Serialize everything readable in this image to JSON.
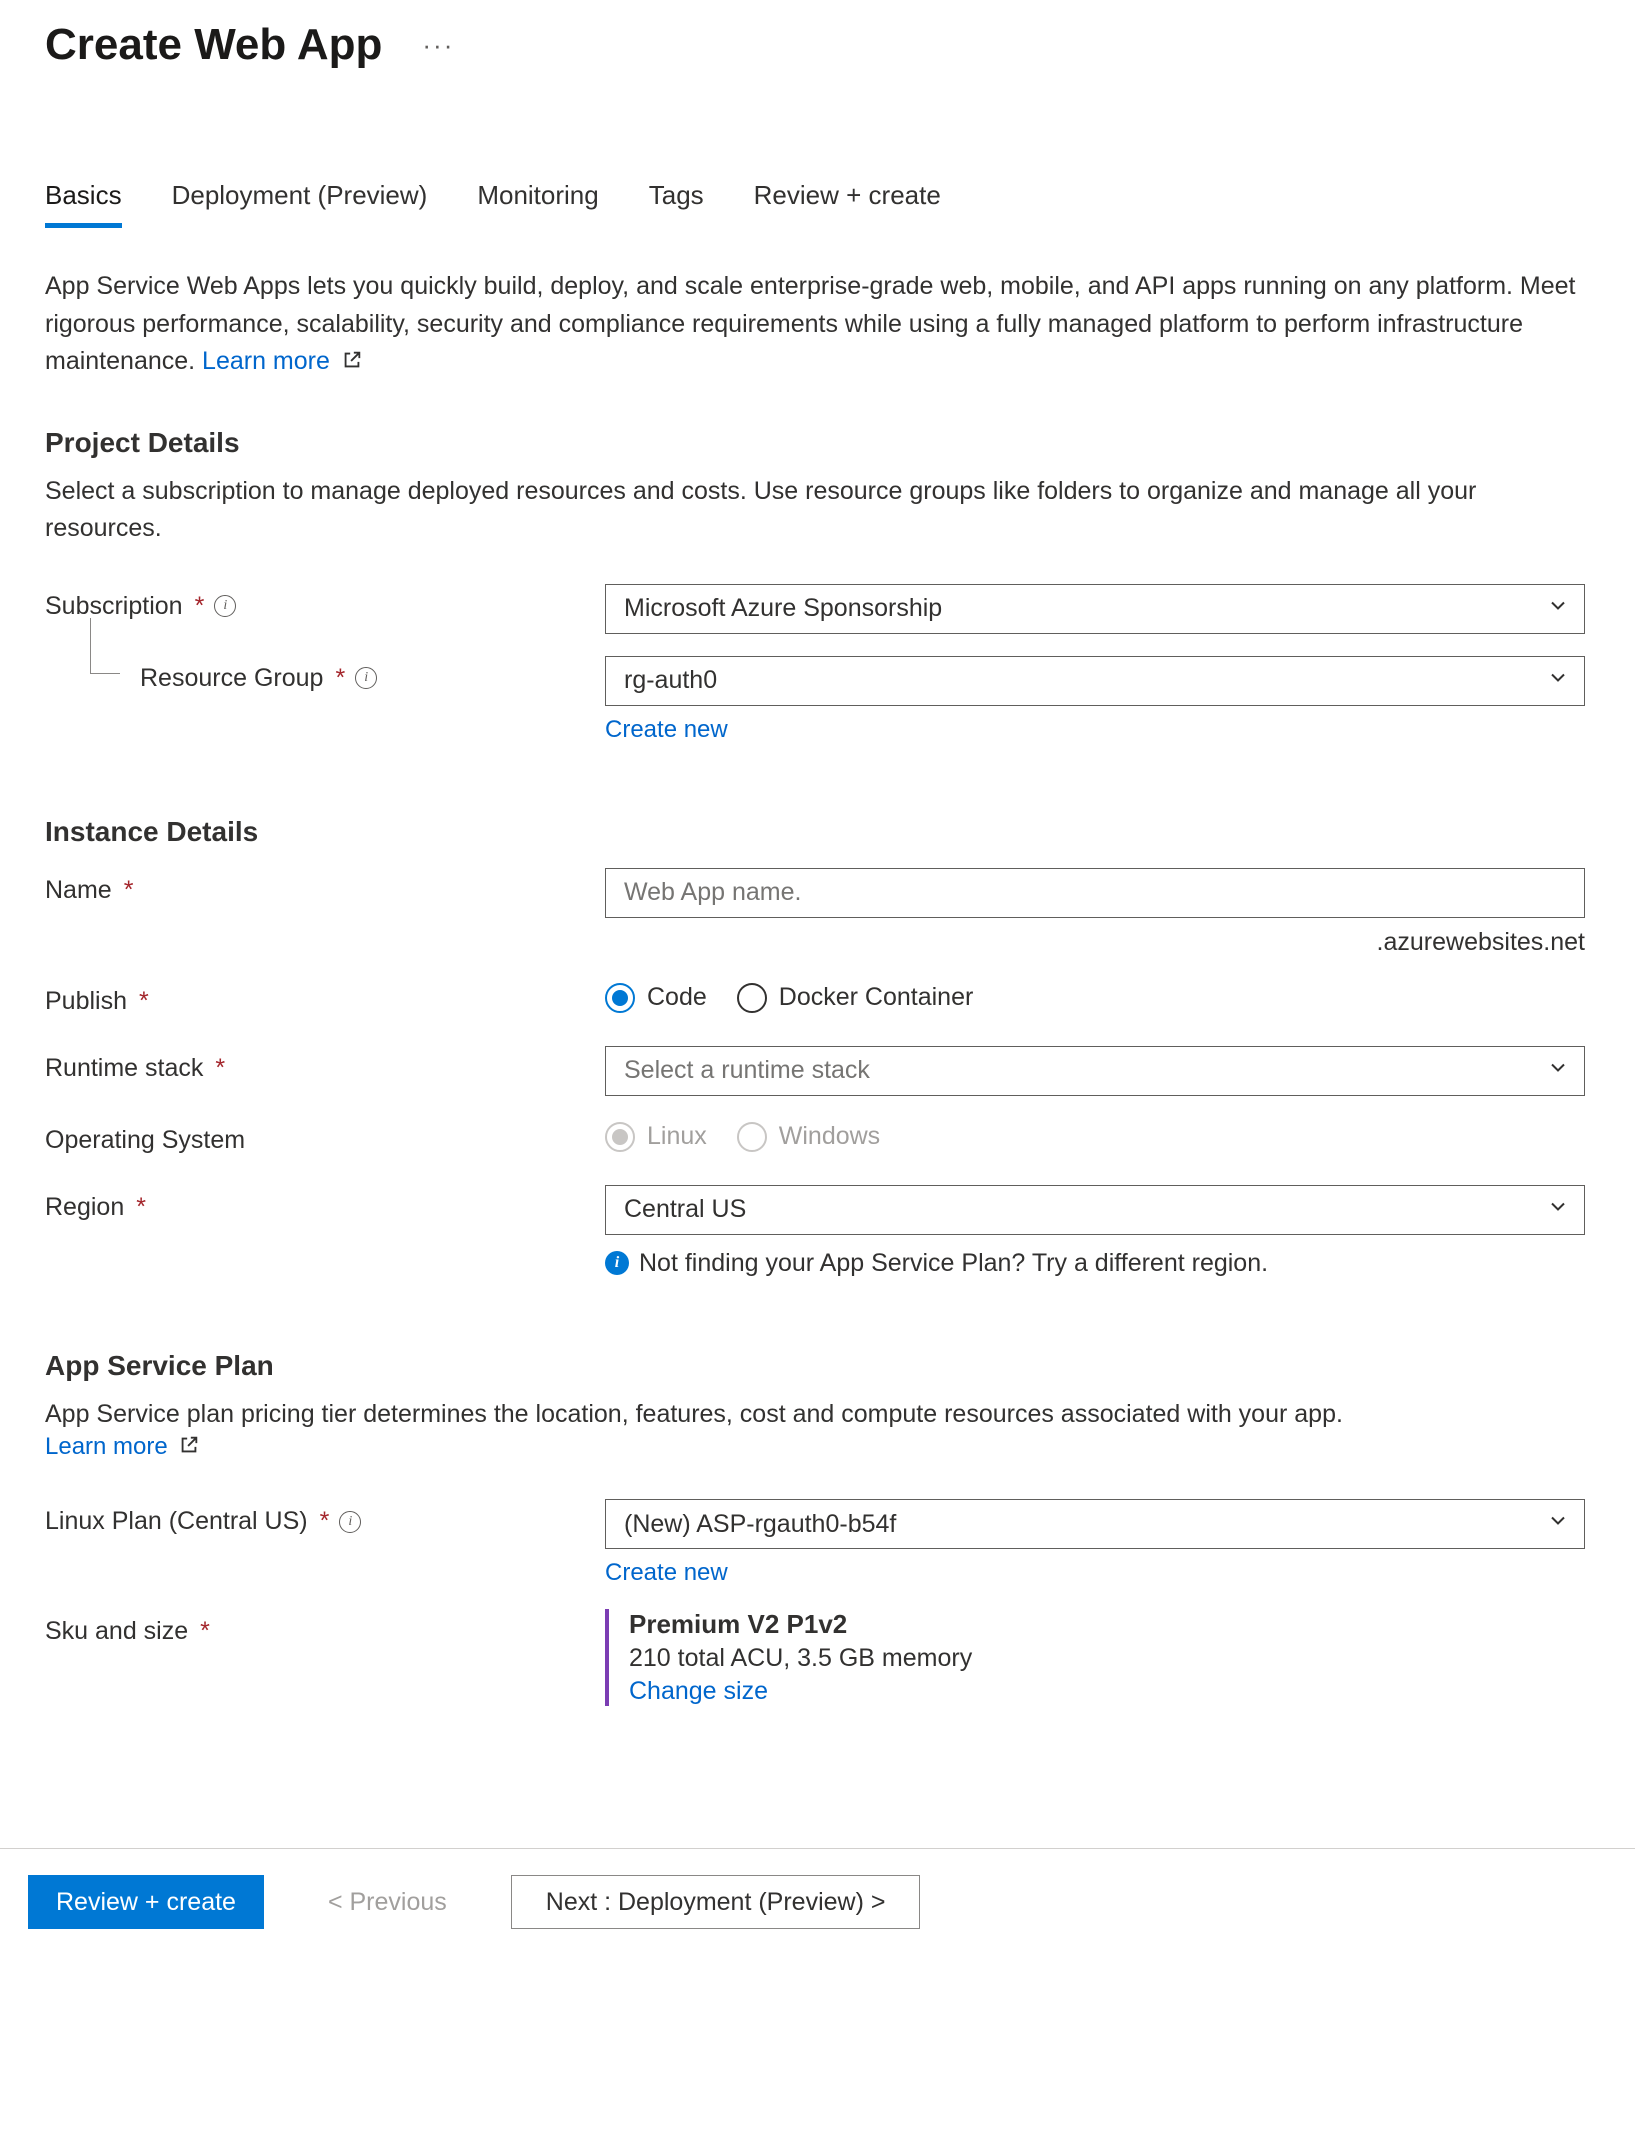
{
  "header": {
    "title": "Create Web App"
  },
  "tabs": [
    {
      "label": "Basics",
      "active": true
    },
    {
      "label": "Deployment (Preview)",
      "active": false
    },
    {
      "label": "Monitoring",
      "active": false
    },
    {
      "label": "Tags",
      "active": false
    },
    {
      "label": "Review + create",
      "active": false
    }
  ],
  "intro": {
    "text": "App Service Web Apps lets you quickly build, deploy, and scale enterprise-grade web, mobile, and API apps running on any platform. Meet rigorous performance, scalability, security and compliance requirements while using a fully managed platform to perform infrastructure maintenance.  ",
    "learn_more": "Learn more"
  },
  "project": {
    "title": "Project Details",
    "desc": "Select a subscription to manage deployed resources and costs. Use resource groups like folders to organize and manage all your resources.",
    "subscription_label": "Subscription",
    "subscription_value": "Microsoft Azure Sponsorship",
    "resource_group_label": "Resource Group",
    "resource_group_value": "rg-auth0",
    "create_new": "Create new"
  },
  "instance": {
    "title": "Instance Details",
    "name_label": "Name",
    "name_placeholder": "Web App name.",
    "name_suffix": ".azurewebsites.net",
    "publish_label": "Publish",
    "publish_options": {
      "code": "Code",
      "docker": "Docker Container"
    },
    "runtime_label": "Runtime stack",
    "runtime_placeholder": "Select a runtime stack",
    "os_label": "Operating System",
    "os_options": {
      "linux": "Linux",
      "windows": "Windows"
    },
    "region_label": "Region",
    "region_value": "Central US",
    "region_hint": "Not finding your App Service Plan? Try a different region."
  },
  "plan": {
    "title": "App Service Plan",
    "desc": "App Service plan pricing tier determines the location, features, cost and compute resources associated with your app.",
    "learn_more": "Learn more",
    "plan_label": "Linux Plan (Central US)",
    "plan_value": "(New) ASP-rgauth0-b54f",
    "create_new": "Create new",
    "sku_label": "Sku and size",
    "sku_name": "Premium V2 P1v2",
    "sku_detail": "210 total ACU, 3.5 GB memory",
    "change_size": "Change size"
  },
  "footer": {
    "review": "Review + create",
    "previous": "< Previous",
    "next": "Next : Deployment (Preview) >"
  }
}
